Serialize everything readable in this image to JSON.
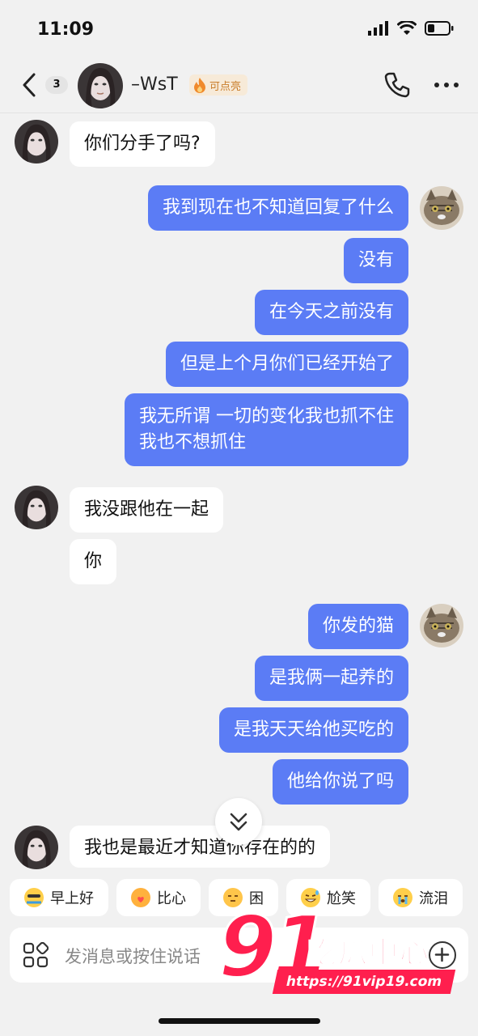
{
  "status_bar": {
    "time": "11:09"
  },
  "header": {
    "unread_count": "3",
    "contact_name": "–WsT",
    "tag_label": "可点亮"
  },
  "messages": [
    {
      "side": "in",
      "text": "你们分手了吗?"
    },
    {
      "side": "out",
      "text": "我到现在也不知道回复了什么"
    },
    {
      "side": "out",
      "text": "没有"
    },
    {
      "side": "out",
      "text": "在今天之前没有"
    },
    {
      "side": "out",
      "text": "但是上个月你们已经开始了"
    },
    {
      "side": "out",
      "text_line1": "我无所谓 一切的变化我也抓不住",
      "text_line2": "我也不想抓住"
    },
    {
      "side": "in",
      "text": "我没跟他在一起"
    },
    {
      "side": "in",
      "text": "你"
    },
    {
      "side": "out",
      "text": "你发的猫"
    },
    {
      "side": "out",
      "text": "是我俩一起养的"
    },
    {
      "side": "out",
      "text": "是我天天给他买吃的"
    },
    {
      "side": "out",
      "text": "他给你说了吗"
    },
    {
      "side": "in",
      "text": "我也是最近才知道你存在的的"
    }
  ],
  "quick_replies": [
    {
      "label": "早上好",
      "icon": "sunrise-emoji-icon"
    },
    {
      "label": "比心",
      "icon": "heart-hands-emoji-icon"
    },
    {
      "label": "困",
      "icon": "sleepy-emoji-icon"
    },
    {
      "label": "尬笑",
      "icon": "sweat-smile-emoji-icon"
    },
    {
      "label": "流泪",
      "icon": "crying-emoji-icon"
    }
  ],
  "input": {
    "placeholder": "发消息或按住说话"
  },
  "watermark": {
    "number": "91",
    "name": "吃瓜中心",
    "url": "https://91vip19.com"
  },
  "colors": {
    "outgoing_bubble": "#5b7cf5",
    "incoming_bubble": "#ffffff",
    "background": "#f1f1f1",
    "watermark": "#ff1f4e"
  }
}
